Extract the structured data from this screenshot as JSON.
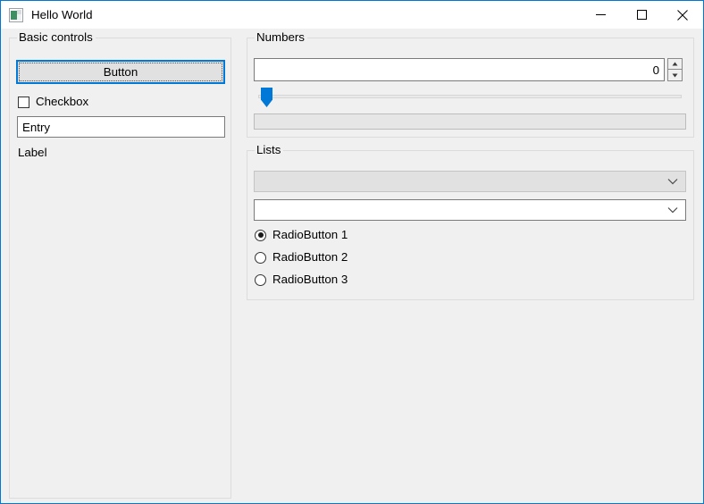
{
  "window": {
    "title": "Hello World",
    "icon": "app-window-icon",
    "accent_color": "#0078d7",
    "frame_color": "#0078d7",
    "client_background": "#f0f0f0",
    "controls": {
      "minimize": "minimize-icon",
      "maximize": "maximize-icon",
      "close": "close-icon"
    }
  },
  "basic_controls": {
    "group_label": "Basic controls",
    "button_label": "Button",
    "button_focused": true,
    "checkbox_label": "Checkbox",
    "checkbox_checked": false,
    "entry_value": "Entry",
    "entry_placeholder": "",
    "label_text": "Label"
  },
  "numbers": {
    "group_label": "Numbers",
    "spin_value": "0",
    "spin_up_icon": "triangle-up-icon",
    "spin_down_icon": "triangle-down-icon",
    "slider_value": 0,
    "slider_min": 0,
    "slider_max": 100,
    "progress_value": 0,
    "progress_min": 0,
    "progress_max": 100
  },
  "lists": {
    "group_label": "Lists",
    "combo_readonly_value": "",
    "combo_readonly_icon": "chevron-down-icon",
    "combo_editable_value": "",
    "combo_editable_placeholder": "",
    "combo_editable_icon": "chevron-down-icon",
    "radios": [
      {
        "label": "RadioButton 1",
        "selected": true
      },
      {
        "label": "RadioButton 2",
        "selected": false
      },
      {
        "label": "RadioButton 3",
        "selected": false
      }
    ]
  }
}
